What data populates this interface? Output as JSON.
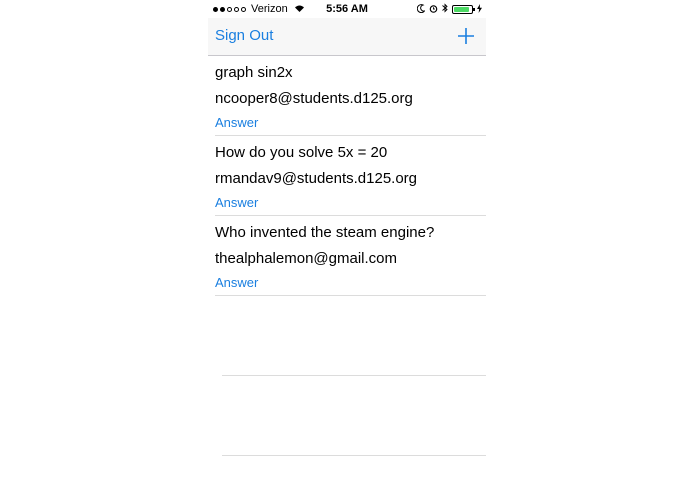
{
  "status_bar": {
    "carrier": "Verizon",
    "time": "5:56 AM",
    "signal_bars_filled": 2,
    "signal_bars_total": 5,
    "battery_level": 0.9,
    "icons": [
      "wifi-icon",
      "moon-icon",
      "alarm-icon",
      "bluetooth-icon",
      "battery-icon",
      "charging-icon"
    ]
  },
  "nav": {
    "sign_out_label": "Sign Out",
    "add_icon": "plus-icon"
  },
  "questions": [
    {
      "question": "graph sin2x",
      "email": "ncooper8@students.d125.org",
      "answer_label": "Answer"
    },
    {
      "question": "How do you solve 5x = 20",
      "email": "rmandav9@students.d125.org",
      "answer_label": "Answer"
    },
    {
      "question": "Who invented the steam engine?",
      "email": "thealphalemon@gmail.com",
      "answer_label": "Answer"
    }
  ],
  "colors": {
    "accent": "#1a7fe0",
    "battery": "#4cd964",
    "navbar_bg": "#f7f7f7",
    "separator": "#dcdcdc"
  }
}
